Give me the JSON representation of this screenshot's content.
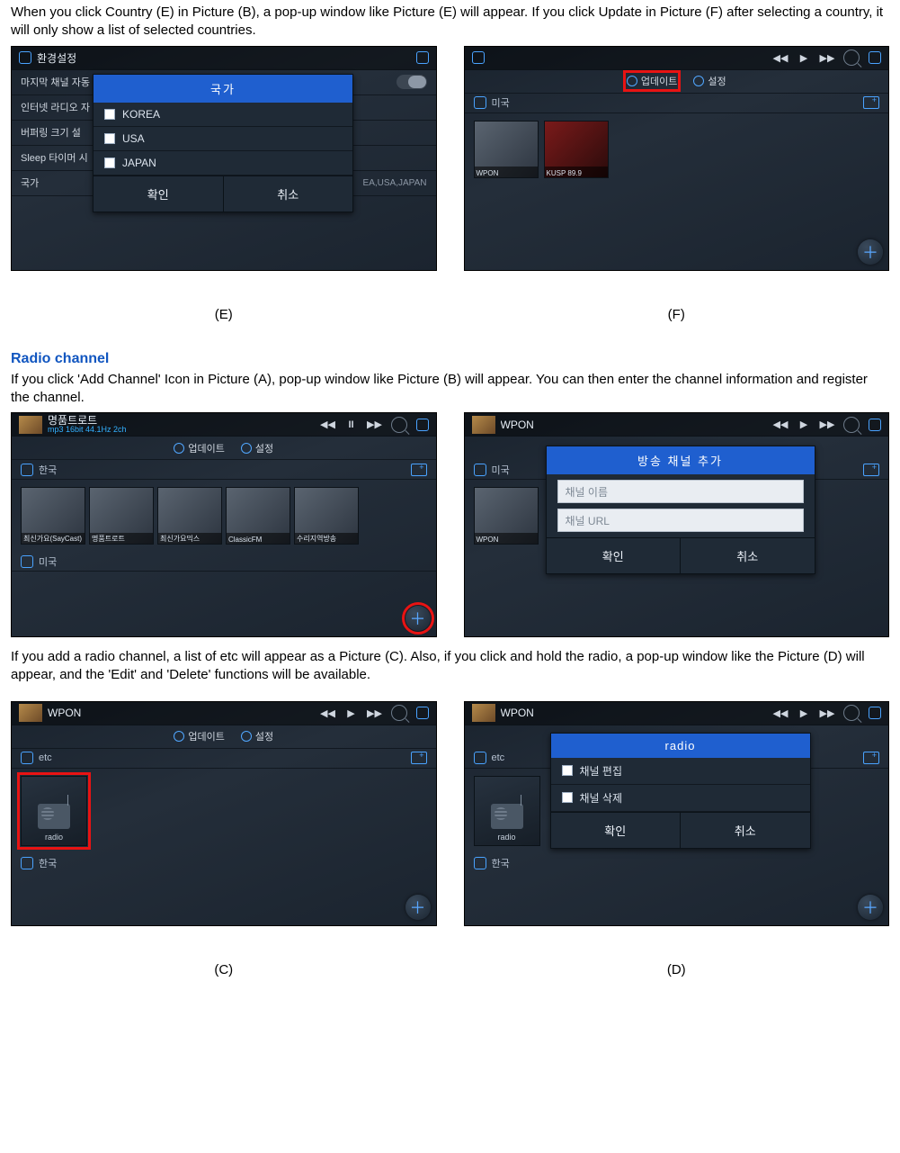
{
  "text": {
    "p1": "When you click Country (E) in Picture (B), a pop-up window like Picture (E) will appear. If you click Update in Picture (F) after selecting a country, it will only show a list of selected countries.",
    "radio_heading": "Radio channel",
    "p2": "If you click 'Add Channel' Icon in Picture (A), pop-up window like Picture (B) will appear. You can then enter the channel information and register the channel.",
    "p3": "If you add a radio channel, a list of etc will appear as a Picture (C). Also, if you click and hold the radio, a pop-up window like the Picture (D) will appear, and the 'Edit' and 'Delete' functions will be available."
  },
  "labels": {
    "E": "(E)",
    "F": "(F)",
    "C": "(C)",
    "D": "(D)"
  },
  "common": {
    "confirm": "확인",
    "cancel": "취소",
    "update": "업데이트",
    "settings": "설정",
    "off": "OFF"
  },
  "shotE": {
    "title": "환경설정",
    "rows": [
      "마지막 채널 자동",
      "인터넷 라디오 자",
      "버퍼링 크기 설",
      "Sleep 타이머 시",
      "국가"
    ],
    "country_val": "EA,USA,JAPAN",
    "popup_title": "국가",
    "countries": [
      "KOREA",
      "USA",
      "JAPAN"
    ]
  },
  "shotF": {
    "country": "미국",
    "thumbs": [
      "WPON",
      "KUSP 89.9"
    ]
  },
  "shotA": {
    "title": "명품트로트",
    "sub": "mp3 16bit 44.1Hz 2ch",
    "country1": "한국",
    "country2": "미국",
    "thumbs": [
      "최신가요(SayCast)",
      "명품트로트",
      "최신가요믹스",
      "ClassicFM",
      "수리지역방송"
    ]
  },
  "shotB2": {
    "title": "WPON",
    "country": "미국",
    "popup_title": "방송 채널 추가",
    "ph_name": "채널 이름",
    "ph_url": "채널 URL"
  },
  "shotC2": {
    "title": "WPON",
    "cat": "etc",
    "tile": "radio",
    "country": "한국"
  },
  "shotD2": {
    "title": "WPON",
    "cat": "etc",
    "tile": "radio",
    "country": "한국",
    "popup_title": "radio",
    "opt_edit": "채널 편집",
    "opt_delete": "채널 삭제"
  }
}
